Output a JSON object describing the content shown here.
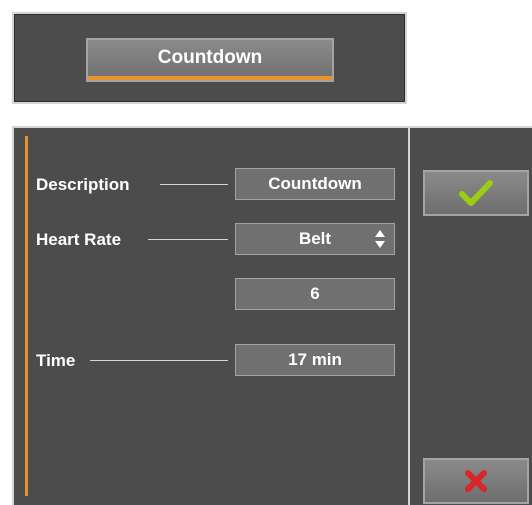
{
  "header": {
    "mode_button_label": "Countdown"
  },
  "form": {
    "rows": [
      {
        "label": "Description",
        "value": "Countdown"
      },
      {
        "label": "Heart Rate",
        "value": "Belt"
      },
      {
        "label": "",
        "value": "6"
      },
      {
        "label": "Time",
        "value": "17 min"
      }
    ]
  },
  "actions": {
    "confirm_icon": "checkmark-icon",
    "cancel_icon": "x-icon"
  },
  "colors": {
    "panel_background": "#4c4c4c",
    "accent": "#e8922d",
    "confirm": "#9acd14",
    "cancel": "#d8262b"
  }
}
